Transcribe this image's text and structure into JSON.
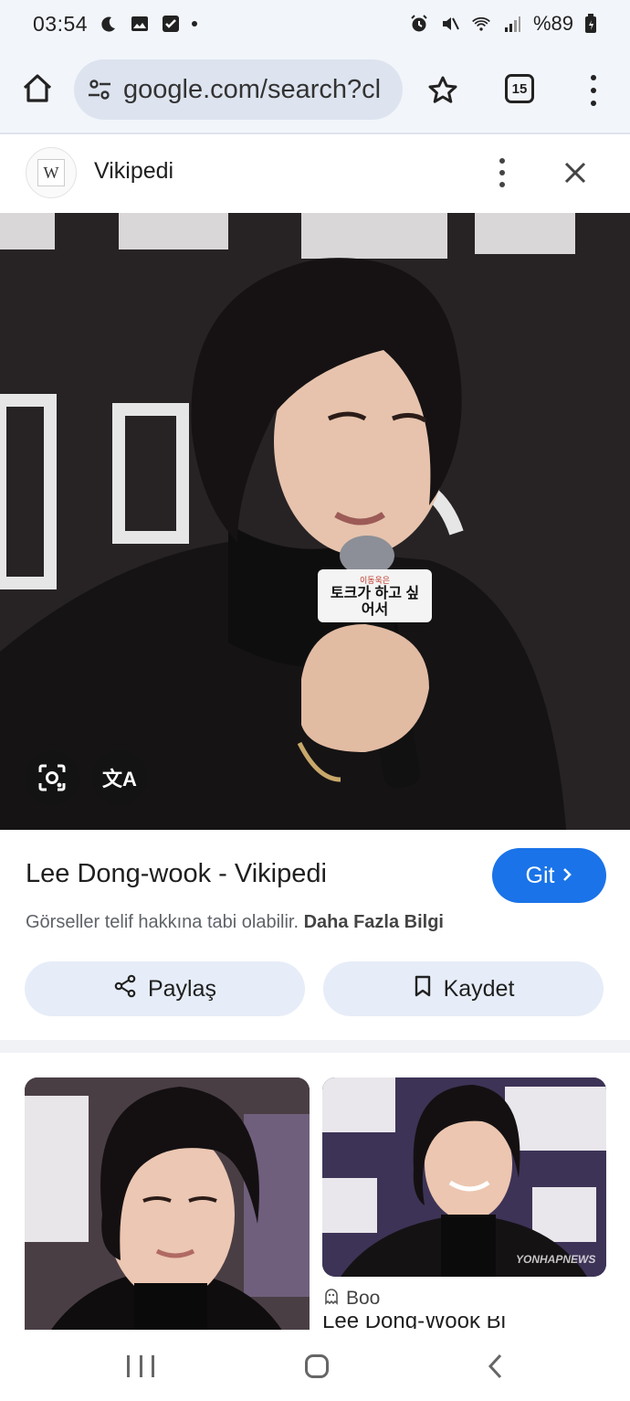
{
  "status_bar": {
    "time": "03:54",
    "battery": "%89",
    "icons": [
      "moon-icon",
      "gallery-icon",
      "checkbox-icon",
      "alarm-icon",
      "mute-icon",
      "wifi-icon",
      "signal-icon",
      "battery-icon"
    ]
  },
  "browser": {
    "url": "google.com/search?cl",
    "tab_count": "15"
  },
  "panel": {
    "source_logo_letter": "W",
    "source_name": "Vikipedi"
  },
  "result": {
    "title": "Lee Dong-wook - Vikipedi",
    "visit_label": "Git",
    "copyright_text": "Görseller telif hakkına tabi olabilir.",
    "learn_more": "Daha Fazla Bilgi",
    "share_label": "Paylaş",
    "save_label": "Kaydet"
  },
  "image_overlay": {
    "mic_flag_text": "토크가 하고 싶어서",
    "mic_flag_small": "이동욱은",
    "translate_glyph": "文A"
  },
  "related": [
    {
      "source": "",
      "title": ""
    },
    {
      "source": "Boo",
      "title": "Lee Dong-Wook Bi",
      "watermark": "YONHAPNEWS"
    }
  ],
  "colors": {
    "accent": "#1a73e8",
    "chrome_bg": "#f2f5fa",
    "url_bg": "#dde4ef",
    "action_bg": "#e6edf8"
  }
}
